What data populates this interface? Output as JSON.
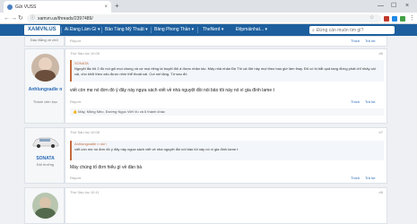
{
  "browser": {
    "tab_title": "Gửi VUSS",
    "tab_close": "×",
    "new_tab": "+",
    "url": "xamvn.us/threads/2397489/",
    "window_controls": {
      "minimize": "—",
      "maximize": "☐",
      "close": "×"
    }
  },
  "site": {
    "logo": "XAMVN.US",
    "nav": [
      {
        "label": "Ai Đang Làm Gì ▾"
      },
      {
        "label": "Bảo Tàng Mỹ Thuật ▾"
      },
      {
        "label": "Bảng Phong Thần ▾"
      },
      {
        "label": "TheNerd ▾"
      },
      {
        "label": "Đệpmáinhat... ▾"
      }
    ],
    "search_placeholder": "Đừng cần muốn tìm gì?"
  },
  "posts": [
    {
      "username": "",
      "user_title": "Đầu Bằng về chữ",
      "report": "Report",
      "like": "Thích",
      "reply": "Trả lời"
    },
    {
      "meta": "Thứ Sáu lúc 10:05",
      "number": "#6",
      "username": "Anhlungxadie n",
      "user_title": "Thành viên bọc",
      "quote_author": "SONATA",
      "quote_text": "Nguyệt lắc tôi 2 đồ nói gối mọi chung và vợ mọi riêng là truyệt đối á được nhận tác. Máy nhà nhận Đẹ Thì cả đời này mọi theo bao giờ làm thay. Đủ có bị bắt quả tang đừng phát chỉ nhảy cái cái, cho khỏi theo xấu được nhìn thể thoát cái. Cut nơi lặng. Tớ sau đó",
      "text": "viết còn mẹ nó đơn đó ý đây này ngựa sách viết về nhà nguyệt đồi nói bảo tôi này nó vì gia đình lame t",
      "report": "Report",
      "like": "Thích",
      "reply": "Trả lời",
      "likes_text": "Máy, Mông Mèo, Đường Ngọc Viết Vu và 6 thành khác"
    },
    {
      "meta": "Thứ Sáu lúc 10:08",
      "number": "#7",
      "username": "SONATA",
      "user_title": "Đội trưởng",
      "quote_author": "Anhlungxadie n nói ›",
      "quote_text": "viết còn mẹ nó đơn đó ý đây này ngựa sách viết về nhà nguyệt đồi nói bảo tôi này nó vì gia đình lame t",
      "text": "Máy chúng tố đơn hiểu gì về đàn bà",
      "report": "Report",
      "like": "Thích",
      "reply": "Trả lời"
    },
    {
      "meta": "Thứ Sáu lúc 10:11",
      "number": "#8"
    }
  ]
}
